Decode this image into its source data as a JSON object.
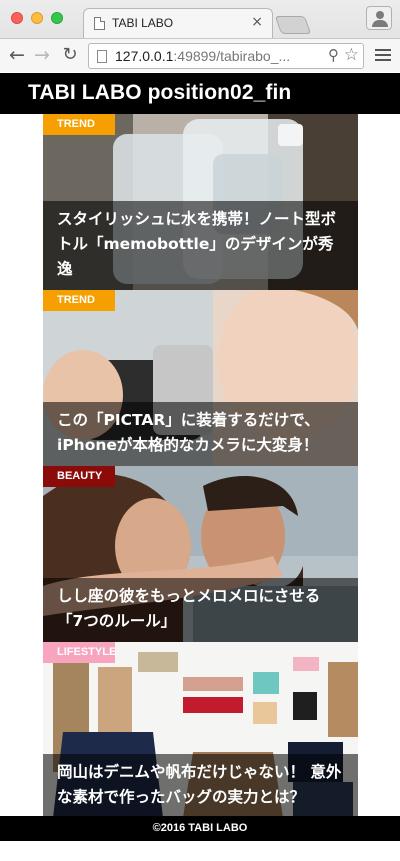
{
  "browser": {
    "tab_title": "TABI LABO",
    "tab_close": "×",
    "url_host": "127.0.0.1",
    "url_rest": ":49899/tabirabo_...",
    "nav": {
      "back": "←",
      "forward": "→",
      "reload": "↻"
    }
  },
  "site": {
    "title": "TABI LABO position02_fin",
    "copyright": "©2016 TABI LABO"
  },
  "articles": [
    {
      "category": "TREND",
      "badge_color": "#f5a000",
      "title": "スタイリッシュに水を携帯！ノート型ボトル「memobottle」のデザインが秀逸"
    },
    {
      "category": "TREND",
      "badge_color": "#f5a000",
      "title": "この「PICTAR」に装着するだけで、iPhoneが本格的なカメラに大変身！"
    },
    {
      "category": "BEAUTY",
      "badge_color": "#8b0a0a",
      "title": "しし座の彼をもっとメロメロにさせる「7つのルール」"
    },
    {
      "category": "LIFESTYLE",
      "badge_color": "#f7a5bf",
      "title": "岡山はデニムや帆布だけじゃない！ 意外な素材で作ったバッグの実力とは？"
    }
  ],
  "colors": {
    "header_bg": "#000000",
    "caption_overlay": "rgba(0,0,0,0.55)"
  }
}
